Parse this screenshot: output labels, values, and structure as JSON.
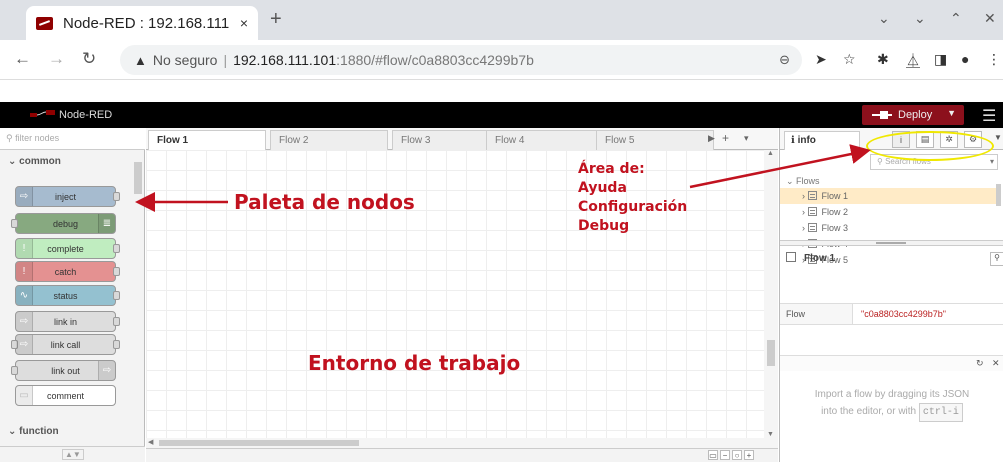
{
  "browser": {
    "tab_title": "Node-RED : 192.168.111",
    "tab_close": "×",
    "new_tab": "+",
    "address": {
      "warning_icon": "▲",
      "not_secure": "No seguro",
      "separator": "|",
      "host": "192.168.111.101",
      "path": ":1880/#flow/c0a8803cc4299b7b"
    }
  },
  "header": {
    "app_name": "Node-RED",
    "deploy_label": "Deploy"
  },
  "palette": {
    "filter_placeholder": "filter nodes",
    "categories": [
      "common",
      "function"
    ],
    "nodes": [
      {
        "label": "inject",
        "color": "#a6bbcf"
      },
      {
        "label": "debug",
        "color": "#87a980"
      },
      {
        "label": "complete",
        "color": "#c0edc0"
      },
      {
        "label": "catch",
        "color": "#e49191"
      },
      {
        "label": "status",
        "color": "#94c1d0"
      },
      {
        "label": "link in",
        "color": "#dddddd"
      },
      {
        "label": "link call",
        "color": "#dddddd"
      },
      {
        "label": "link out",
        "color": "#dddddd"
      },
      {
        "label": "comment",
        "color": "#ffffff"
      }
    ]
  },
  "workspace": {
    "tabs": [
      "Flow 1",
      "Flow 2",
      "Flow 3",
      "Flow 4",
      "Flow 5"
    ],
    "active_tab": "Flow 1"
  },
  "sidebar": {
    "info_tab": "info",
    "search_placeholder": "Search flows",
    "tree_root": "Flows",
    "tree_items": [
      "Flow 1",
      "Flow 2",
      "Flow 3",
      "Flow 4",
      "Flow 5"
    ],
    "selected_flow_title": "Flow 1",
    "property_key": "Flow",
    "property_value": "\"c0a8803cc4299b7b\"",
    "help_line1": "Import a flow by dragging its JSON",
    "help_line2": "into the editor, or with",
    "help_kbd": "ctrl-i"
  },
  "annotations": {
    "area_title": "Área de:",
    "area_lines": [
      "Ayuda",
      "Configuración",
      "Debug"
    ],
    "palette_label": "Paleta de nodos",
    "workspace_label": "Entorno de trabajo",
    "annotation_color": "#c1121f",
    "highlight_color": "#f0e800"
  }
}
